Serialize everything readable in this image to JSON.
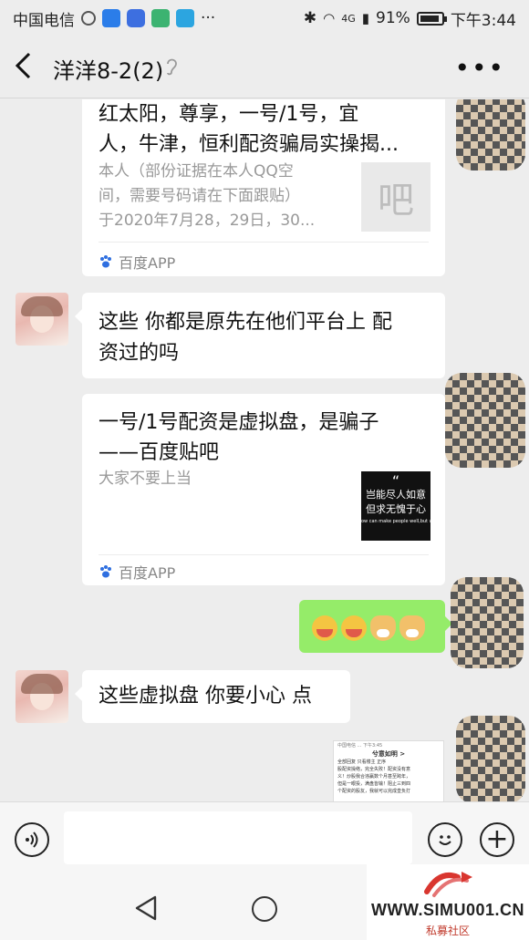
{
  "status_bar": {
    "carrier": "中国电信",
    "battery": "91%",
    "battery_level": 0.91,
    "time": "下午3:44",
    "network": "4G"
  },
  "header": {
    "back_icon": "chevron-left-icon",
    "title": "洋洋8-2(2)",
    "muted_icon": "ear-icon",
    "more_icon": "ellipsis-icon"
  },
  "messages": {
    "card1": {
      "title_line1": "红太阳，尊享，一号/1号，宜",
      "title_line2": "人，牛津，恒利配资骗局实操揭...",
      "desc_line1": "本人（部份证据在本人QQ空",
      "desc_line2": "间，需要号码请在下面跟贴）",
      "desc_line3": "于2020年7月28，29日，30...",
      "thumb_text": "吧",
      "source": "百度APP"
    },
    "msg1": {
      "line1": "这些 你都是原先在他们平台上 配",
      "line2": "资过的吗"
    },
    "card2": {
      "title_line1": "一号/1号配资是虚拟盘，是骗子",
      "title_line2": "——百度贴吧",
      "desc": "大家不要上当",
      "thumb_quote": "“",
      "thumb_line1": "岂能尽人如意",
      "thumb_line2": "但求无愧于心",
      "thumb_line3": "ow can make people well,but wor",
      "source": "百度APP"
    },
    "msg2": {
      "text": "这些虚拟盘 你要小心 点"
    },
    "screenshot_thumb": {
      "top": "中国电信 ... 下午3:45",
      "title": "兮意如明 >",
      "tabs": "全部回复     只看楼主         正序",
      "body1": "股配资操络，完全失败！配资没有意",
      "body2": "义！炒股我合违赢数个月甚至跨年，",
      "body3": "但是一眼投，满盘皆输！阻止三到四",
      "body4": "个配资的股友，我就可以完成皇负打"
    }
  },
  "input_bar": {
    "voice_icon": "voice-icon",
    "emoji_icon": "smile-icon",
    "plus_icon": "plus-icon"
  },
  "watermark": {
    "url": "WWW.SIMU001.CN",
    "sub": "私募社区"
  }
}
